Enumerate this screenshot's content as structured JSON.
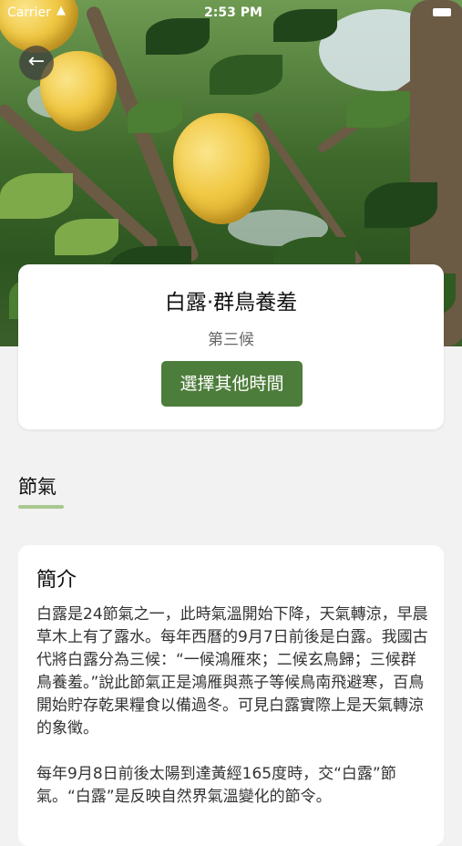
{
  "status_bar": {
    "carrier": "Carrier",
    "time": "2:53 PM"
  },
  "header": {
    "back_icon": "arrow-left-icon"
  },
  "hero": {
    "image": "pomelo-tree"
  },
  "card": {
    "title": "白露·群鳥養羞",
    "subtitle": "第三候",
    "button_label": "選擇其他時間"
  },
  "section": {
    "tab_label": "節氣"
  },
  "intro": {
    "heading": "簡介",
    "paragraphs": [
      "白露是24節氣之一，此時氣溫開始下降，天氣轉涼，早晨草木上有了露水。每年西曆的9月7日前後是白露。我國古代將白露分為三候：“一候鴻雁來；二候玄鳥歸；三候群鳥養羞。”說此節氣正是鴻雁與燕子等候鳥南飛避寒，百鳥開始貯存乾果糧食以備過冬。可見白露實際上是天氣轉涼的象徵。",
      " 每年9月8日前後太陽到達黃經165度時，交“白露”節氣。“白露”是反映自然界氣溫變化的節令。"
    ]
  },
  "colors": {
    "accent": "#4d7d3b",
    "tab_underline": "#a9c88f",
    "background": "#f2f2f2"
  }
}
